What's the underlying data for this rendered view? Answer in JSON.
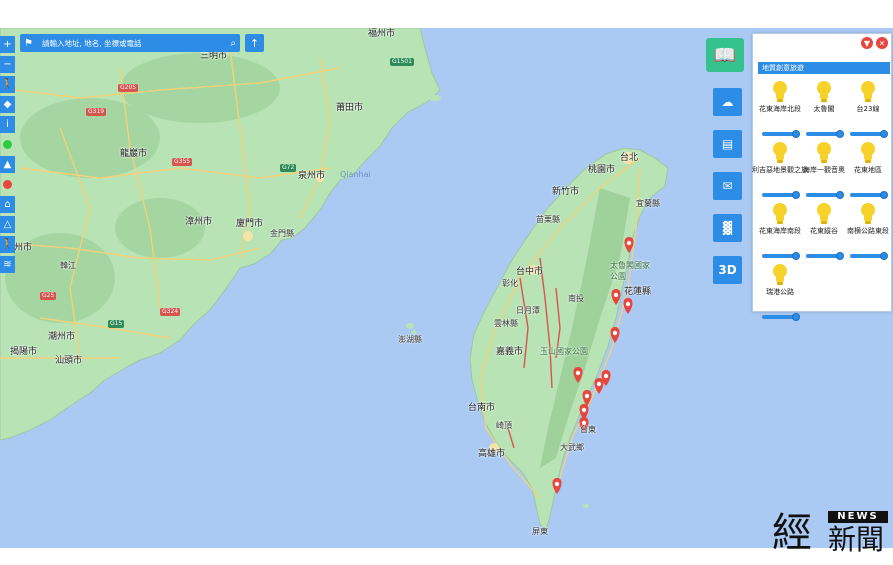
{
  "search": {
    "placeholder": "請輸入地址, 地名, 坐標或電話"
  },
  "toolbar_left": [
    {
      "icon": "plus-icon",
      "glyph": "+"
    },
    {
      "icon": "minus-icon",
      "glyph": "−"
    },
    {
      "icon": "walker-icon",
      "glyph": "🚶"
    },
    {
      "icon": "dropbox-icon",
      "glyph": "◆"
    },
    {
      "icon": "info-icon",
      "glyph": "i"
    },
    {
      "icon": "green-dot-icon",
      "color": "#2ecc40"
    },
    {
      "icon": "water-drop-icon",
      "glyph": "💧"
    },
    {
      "icon": "red-dot-icon",
      "color": "#e8453c"
    },
    {
      "icon": "bank-icon",
      "glyph": "🏛"
    },
    {
      "icon": "mountain-icon",
      "glyph": "⛰"
    },
    {
      "icon": "hiker-icon",
      "glyph": "🚶"
    },
    {
      "icon": "layers-icon",
      "glyph": "≋"
    }
  ],
  "right_tools": [
    {
      "name": "book-tool",
      "icon": "book-icon"
    },
    {
      "name": "chat-tool",
      "icon": "chat-icon"
    },
    {
      "name": "message-tool",
      "icon": "message-icon"
    },
    {
      "name": "mail-tool",
      "icon": "mail-icon"
    },
    {
      "name": "factory-tool",
      "icon": "factory-icon"
    },
    {
      "name": "3d-tool",
      "icon": "3d-icon",
      "label": "3D"
    }
  ],
  "panel": {
    "title": "地質創意旅遊",
    "layers": [
      {
        "name": "花東海岸北段"
      },
      {
        "name": "太魯閣"
      },
      {
        "name": "台23線"
      },
      {
        "name": "利吉惡地景觀之旅"
      },
      {
        "name": "海岸一觀音奧"
      },
      {
        "name": "花東地區"
      },
      {
        "name": "花東海岸南段"
      },
      {
        "name": "花東縱谷"
      },
      {
        "name": "南横公路東段"
      },
      {
        "name": "瑞港公路"
      }
    ]
  },
  "map": {
    "labels": {
      "fuzhou": "福州市",
      "putian": "莆田市",
      "quanzhou": "泉州市",
      "zhangzhou": "漳州市",
      "xiamen": "廈門市",
      "longyan": "龍巖市",
      "sanming": "三明市",
      "meizhou": "梅州市",
      "chaozhou": "潮州市",
      "shantou": "汕頭市",
      "jieyang": "揭陽市",
      "hanjiang": "韓江",
      "kinmen": "金門縣",
      "penghu": "澎湖縣",
      "taipei": "台北",
      "taoyuan": "桃園市",
      "hsinchu": "新竹市",
      "yilan": "宜蘭縣",
      "miaoli": "苗栗縣",
      "taichung": "台中市",
      "nantou": "南投",
      "yunlin": "雲林縣",
      "chiayi": "嘉義市",
      "tainan": "台南市",
      "kaohsiung": "高雄市",
      "pingtung": "屏東",
      "hualien": "花蓮縣",
      "taitung": "台東",
      "taroko": "太魯閣國家公園",
      "yushan": "玉山國家公園",
      "changhua": "彰化",
      "sunmoon": "日月潭",
      "gaotai": "大武鄉",
      "xiamen_strait": "Qianhai",
      "tainan_road": "崎頂"
    },
    "shields": {
      "g319": "G319",
      "g205": "G205",
      "g355": "G355",
      "g324": "G324",
      "g15": "G15",
      "g72": "G72",
      "g1501": "G1501",
      "g25": "G25"
    },
    "markers": 12
  },
  "watermark": {
    "char1": "經",
    "char2": "新聞",
    "news": "NEWS"
  }
}
